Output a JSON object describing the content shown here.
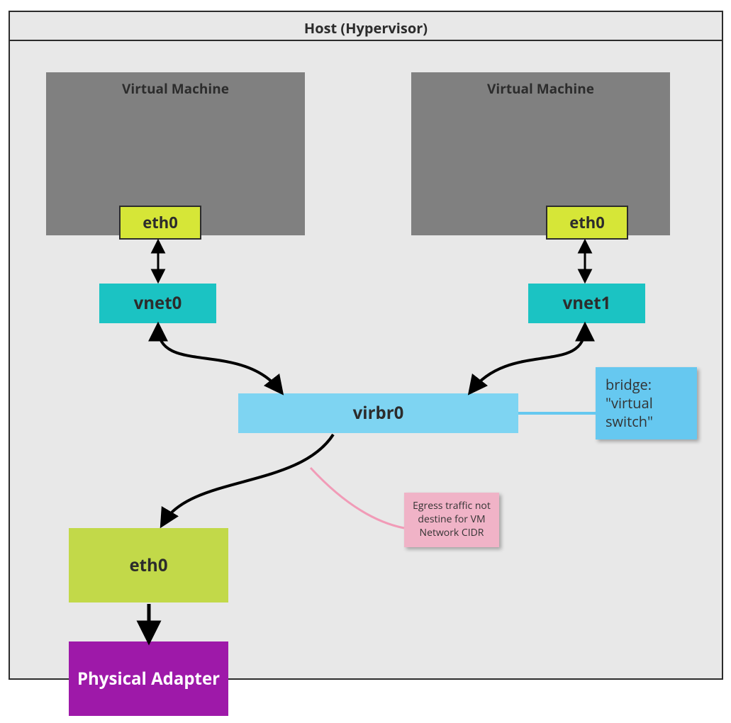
{
  "host": {
    "title": "Host (Hypervisor)"
  },
  "vm1": {
    "title": "Virtual Machine",
    "iface": "eth0"
  },
  "vm2": {
    "title": "Virtual Machine",
    "iface": "eth0"
  },
  "vnet0": {
    "label": "vnet0"
  },
  "vnet1": {
    "label": "vnet1"
  },
  "virbr0": {
    "label": "virbr0"
  },
  "host_eth": {
    "label": "eth0"
  },
  "physical": {
    "label": "Physical Adapter"
  },
  "note_bridge": {
    "text": "bridge: \"virtual switch\""
  },
  "note_egress": {
    "text": "Egress traffic not destine for VM Network CIDR"
  },
  "colors": {
    "bg": "#e8e8e8",
    "border": "#2c2c2c",
    "vm": "#808080",
    "lime": "#d6e637",
    "limeDark": "#c2d949",
    "teal": "#1bc3c3",
    "skyblue": "#7ed4f2",
    "noteBlue": "#66c8f0",
    "notePink": "#f0b3c7",
    "purple": "#9e19a9",
    "arrow": "#000000"
  }
}
